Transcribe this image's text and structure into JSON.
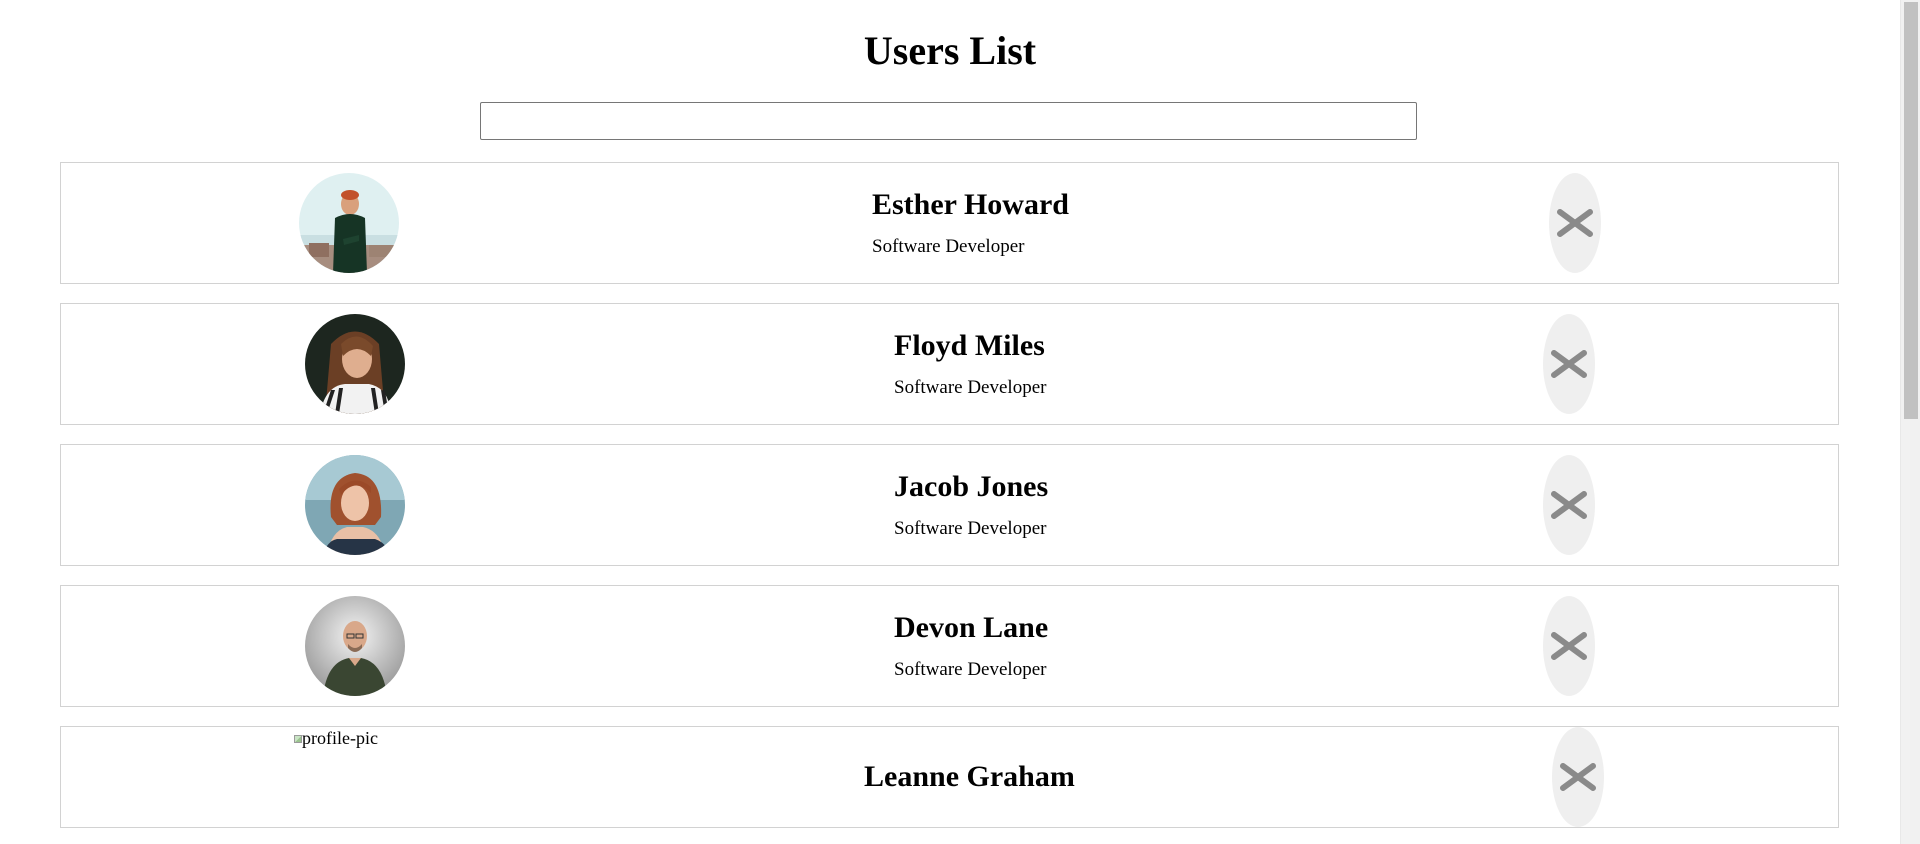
{
  "page": {
    "title": "Users List"
  },
  "search": {
    "value": "",
    "placeholder": ""
  },
  "users": [
    {
      "name": "Esther Howard",
      "role": "Software Developer",
      "avatar": "photo"
    },
    {
      "name": "Floyd Miles",
      "role": "Software Developer",
      "avatar": "photo"
    },
    {
      "name": "Jacob Jones",
      "role": "Software Developer",
      "avatar": "photo"
    },
    {
      "name": "Devon Lane",
      "role": "Software Developer",
      "avatar": "photo"
    },
    {
      "name": "Leanne Graham",
      "role": "",
      "avatar": "broken",
      "avatar_alt": "profile-pic"
    }
  ],
  "icons": {
    "delete": "close-icon"
  },
  "colors": {
    "delete_button_bg": "#efefef",
    "delete_icon": "#8a8a8a",
    "card_border": "#d2d2d2"
  }
}
